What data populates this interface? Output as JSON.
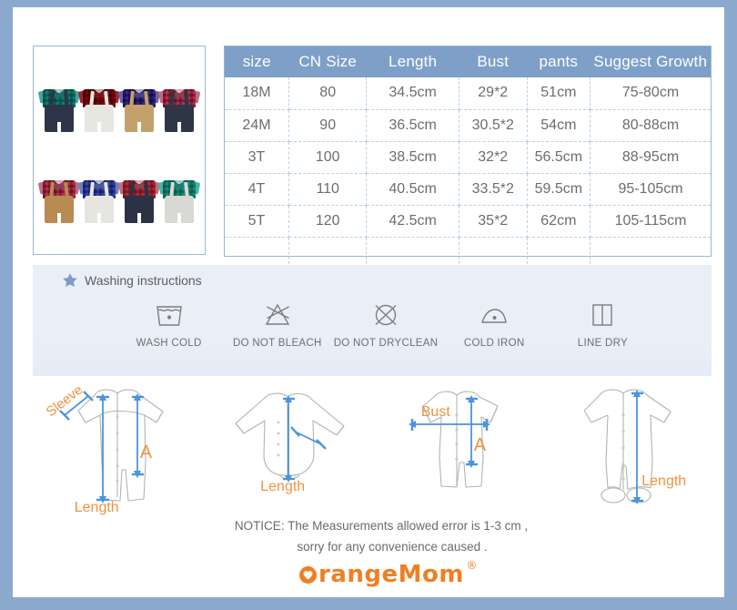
{
  "page": {
    "border_color": "#8aa9cc",
    "accent_blue": "#7e9fc7",
    "accent_orange": "#f0923e"
  },
  "gallery": {
    "name": "product-variants",
    "items": [
      {
        "name": "teal-plaid-navy-overall",
        "shirt": "#3ea8a4",
        "shirt2": "#9bd8d4",
        "pants": "#2d3548",
        "bow": "#1d6f6d"
      },
      {
        "name": "red-plaid-white-overall",
        "shirt": "#a32232",
        "shirt2": "#e0707e",
        "pants": "#e8e6e0",
        "bow": "#7d1220"
      },
      {
        "name": "purple-plaid-khaki-overall",
        "shirt": "#6b5fa8",
        "shirt2": "#b3a9d8",
        "pants": "#c4a16c",
        "bow": "#4b3f85"
      },
      {
        "name": "pink-plaid-navy-overall",
        "shirt": "#c06a84",
        "shirt2": "#efb7c6",
        "pants": "#2f3747",
        "bow": "#8c3f56"
      },
      {
        "name": "pink-plaid-khaki-overall",
        "shirt": "#c06a84",
        "shirt2": "#efb7c6",
        "pants": "#b98a52",
        "bow": "#8c3f56"
      },
      {
        "name": "blue-plaid-white-overall",
        "shirt": "#6f7fbe",
        "shirt2": "#b6c0e4",
        "pants": "#e7e5df",
        "bow": "#4a58a0"
      },
      {
        "name": "rose-plaid-navy-overall",
        "shirt": "#c36b7c",
        "shirt2": "#e9a6b4",
        "pants": "#2b3244",
        "bow": "#8e4050"
      },
      {
        "name": "mint-plaid-grey-overall",
        "shirt": "#3fb5a8",
        "shirt2": "#a3ded6",
        "pants": "#d8d8d4",
        "bow": "#1f7f76"
      }
    ]
  },
  "size_table": {
    "name": "size-chart",
    "headers": [
      "size",
      "CN Size",
      "Length",
      "Bust",
      "pants",
      "Suggest Growth"
    ],
    "rows": [
      [
        "18M",
        "80",
        "34.5cm",
        "29*2",
        "51cm",
        "75-80cm"
      ],
      [
        "24M",
        "90",
        "36.5cm",
        "30.5*2",
        "54cm",
        "80-88cm"
      ],
      [
        "3T",
        "100",
        "38.5cm",
        "32*2",
        "56.5cm",
        "88-95cm"
      ],
      [
        "4T",
        "110",
        "40.5cm",
        "33.5*2",
        "59.5cm",
        "95-105cm"
      ],
      [
        "5T",
        "120",
        "42.5cm",
        "35*2",
        "62cm",
        "105-115cm"
      ],
      [
        "",
        "",
        "",
        "",
        "",
        ""
      ]
    ]
  },
  "washing": {
    "title": "Washing instructions",
    "star_icon": "star-icon",
    "items": [
      {
        "icon": "wash-cold-icon",
        "label": "WASH COLD"
      },
      {
        "icon": "do-not-bleach-icon",
        "label": "DO NOT BLEACH"
      },
      {
        "icon": "do-not-dryclean-icon",
        "label": "DO NOT DRYCLEAN"
      },
      {
        "icon": "cold-iron-icon",
        "label": "COLD IRON"
      },
      {
        "icon": "line-dry-icon",
        "label": "LINE DRY"
      }
    ]
  },
  "diagrams": [
    {
      "name": "long-sleeve-romper",
      "labels": {
        "sleeve": "Sleeve",
        "a": "A",
        "length": "Length"
      }
    },
    {
      "name": "bodysuit",
      "labels": {
        "length": "Length"
      }
    },
    {
      "name": "short-sleeve-romper",
      "labels": {
        "bust": "Bust",
        "a": "A"
      }
    },
    {
      "name": "footed-sleepsuit",
      "labels": {
        "length": "Length"
      }
    }
  ],
  "notice": {
    "line1": "NOTICE:   The Measurements allowed error is 1-3 cm ,",
    "line2": "sorry for any convenience caused ."
  },
  "logo": {
    "text": "rangeMom",
    "registered": "®"
  }
}
